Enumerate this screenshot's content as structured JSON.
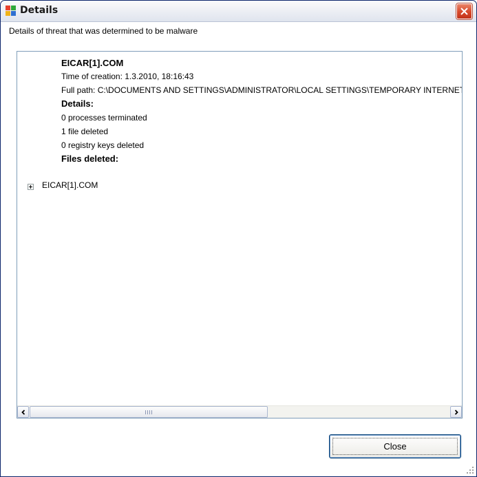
{
  "window": {
    "title": "Details",
    "icon": "avg-app-icon",
    "close_icon": "close-icon"
  },
  "subtitle": "Details of threat that was determined to be malware",
  "tree": {
    "lines": [
      {
        "text": "EICAR[1].COM",
        "bold": true
      },
      {
        "text": "Time of creation: 1.3.2010, 18:16:43",
        "bold": false
      },
      {
        "text": "Full path: C:\\DOCUMENTS AND SETTINGS\\ADMINISTRATOR\\LOCAL SETTINGS\\TEMPORARY INTERNET FILES",
        "bold": false
      },
      {
        "text": "Details:",
        "bold": true
      },
      {
        "text": "0 processes terminated",
        "bold": false
      },
      {
        "text": "1 file deleted",
        "bold": false
      },
      {
        "text": "0 registry keys deleted",
        "bold": false
      },
      {
        "text": "Files deleted:",
        "bold": true
      },
      {
        "text": "EICAR[1].COM",
        "bold": false,
        "expandable": true
      }
    ]
  },
  "buttons": {
    "close_label": "Close"
  },
  "colors": {
    "title_bar": "#dfe4ee",
    "close_button": "#d6482a",
    "panel_border": "#7f9db9"
  }
}
